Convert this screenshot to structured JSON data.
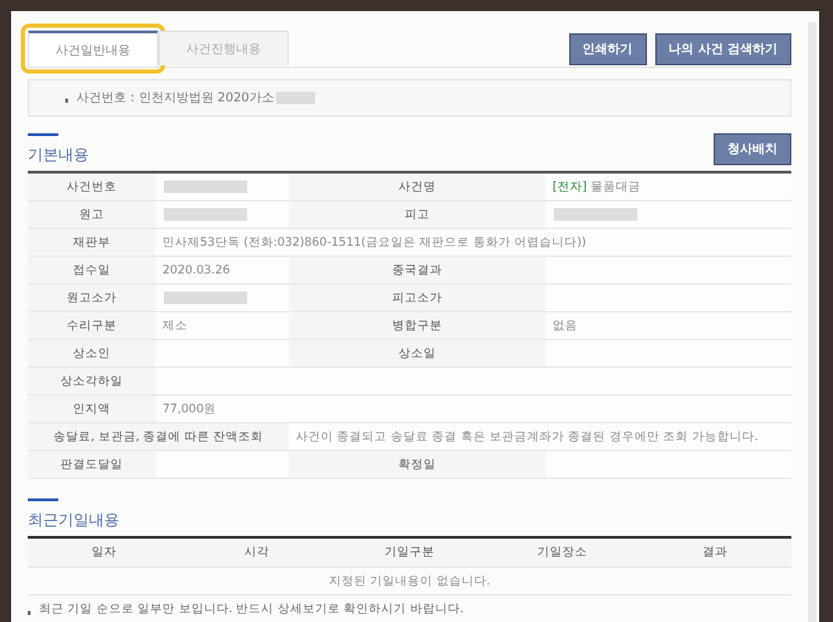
{
  "tabs": [
    {
      "label": "사건일반내용",
      "selected": true,
      "highlighted": true
    },
    {
      "label": "사건진행내용",
      "selected": false,
      "highlighted": false
    }
  ],
  "top_buttons": [
    "인쇄하기",
    "나의 사건 검색하기"
  ],
  "case_number": {
    "text": "사건번호 : 인천지방법원 2020가소",
    "redacted": true
  },
  "basic": {
    "heading": "기본내용",
    "button": "청사배치",
    "rows": [
      [
        {
          "kind": "label",
          "text": "사건번호"
        },
        {
          "kind": "redacted"
        },
        {
          "kind": "label",
          "text": "사건명"
        },
        {
          "kind": "value",
          "tag": "[전자]",
          "text": "물품대금"
        }
      ],
      [
        {
          "kind": "label",
          "text": "원고"
        },
        {
          "kind": "redacted"
        },
        {
          "kind": "label",
          "text": "피고"
        },
        {
          "kind": "redacted"
        }
      ],
      [
        {
          "kind": "label",
          "text": "재판부"
        },
        {
          "kind": "value",
          "text": "민사제53단독 (전화:032)860-1511(금요일은 재판으로 통화가 어렵습니다))"
        }
      ],
      [
        {
          "kind": "label",
          "text": "접수일"
        },
        {
          "kind": "value",
          "text": "2020.03.26"
        },
        {
          "kind": "label",
          "text": "종국결과"
        },
        {
          "kind": "blank"
        }
      ],
      [
        {
          "kind": "label",
          "text": "원고소가"
        },
        {
          "kind": "redacted"
        },
        {
          "kind": "label",
          "text": "피고소가"
        },
        {
          "kind": "blank"
        }
      ],
      [
        {
          "kind": "label",
          "text": "수리구분"
        },
        {
          "kind": "value",
          "text": "제소"
        },
        {
          "kind": "label",
          "text": "병합구분"
        },
        {
          "kind": "value",
          "text": "없음"
        }
      ],
      [
        {
          "kind": "label",
          "text": "상소인"
        },
        {
          "kind": "blank"
        },
        {
          "kind": "label",
          "text": "상소일"
        },
        {
          "kind": "blank"
        }
      ],
      [
        {
          "kind": "label",
          "text": "상소각하일"
        },
        {
          "kind": "blank"
        }
      ],
      [
        {
          "kind": "label",
          "text": "인지액"
        },
        {
          "kind": "value",
          "text": "77,000원"
        }
      ],
      [
        {
          "kind": "wide-label",
          "text": "송달료, 보관금, 종결에 따른 잔액조회"
        },
        {
          "kind": "value",
          "text": "사건이 종결되고 송달료 종결 혹은 보관금계좌가 종결된 경우에만 조회 가능합니다."
        }
      ],
      [
        {
          "kind": "label",
          "text": "판결도달일"
        },
        {
          "kind": "blank"
        },
        {
          "kind": "label",
          "text": "확정일"
        },
        {
          "kind": "blank"
        }
      ]
    ]
  },
  "hearings": {
    "heading": "최근기일내용",
    "columns": [
      "일자",
      "시각",
      "기일구분",
      "기일장소",
      "결과"
    ],
    "empty_message": "지정된 기일내용이 없습니다.",
    "note": "최근 기일 순으로 일부만 보입니다. 반드시 상세보기로 확인하시기 바랍니다."
  }
}
